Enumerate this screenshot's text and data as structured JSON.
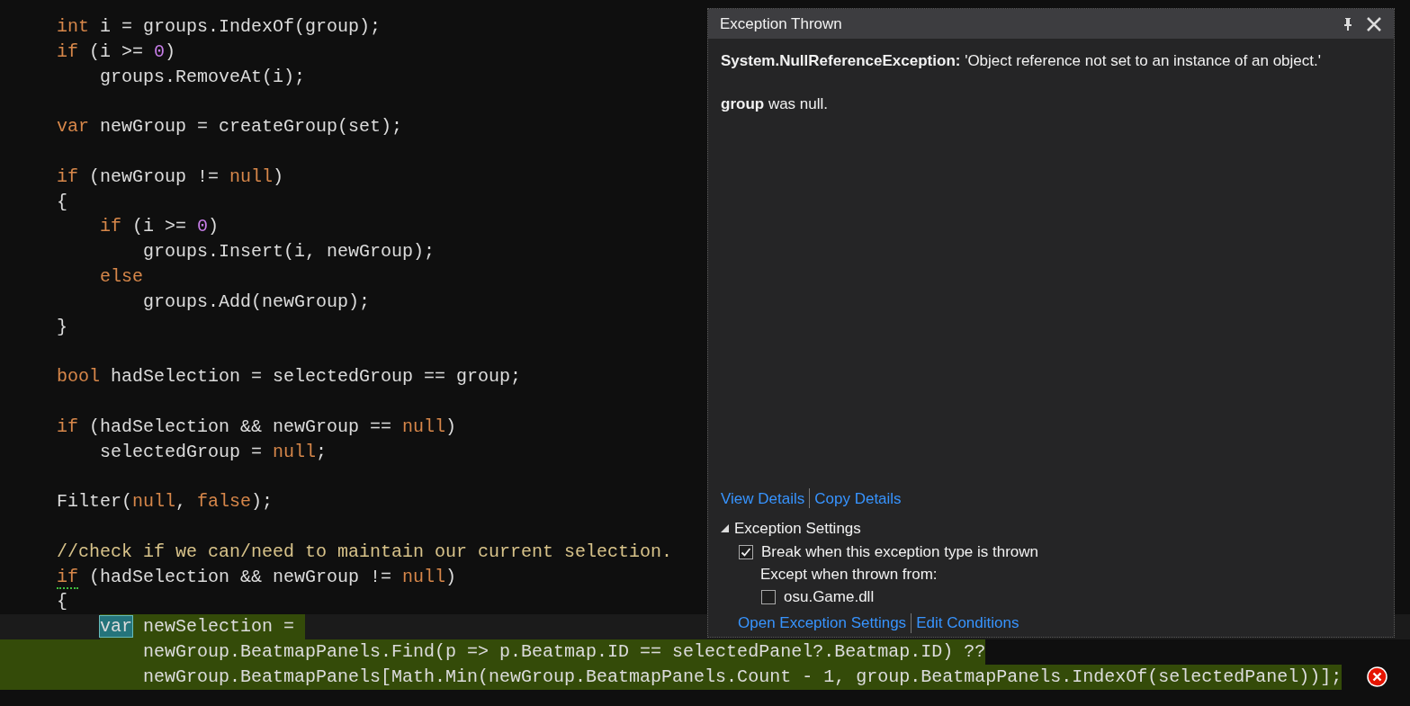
{
  "code": {
    "lines": [
      {
        "kind": "code",
        "tokens": [
          {
            "kind": "keyword",
            "text": "int"
          },
          {
            "kind": "plain",
            "text": " i = groups.IndexOf(group);"
          }
        ]
      },
      {
        "kind": "code",
        "tokens": [
          {
            "kind": "keyword",
            "text": "if"
          },
          {
            "kind": "plain",
            "text": " (i >= "
          },
          {
            "kind": "number",
            "text": "0"
          },
          {
            "kind": "plain",
            "text": ")"
          }
        ]
      },
      {
        "kind": "code",
        "tokens": [
          {
            "kind": "plain",
            "text": "    groups.RemoveAt(i);"
          }
        ]
      },
      {
        "kind": "blank"
      },
      {
        "kind": "code",
        "tokens": [
          {
            "kind": "keyword",
            "text": "var"
          },
          {
            "kind": "plain",
            "text": " newGroup = createGroup(set);"
          }
        ]
      },
      {
        "kind": "blank"
      },
      {
        "kind": "code",
        "tokens": [
          {
            "kind": "keyword",
            "text": "if"
          },
          {
            "kind": "plain",
            "text": " (newGroup != "
          },
          {
            "kind": "keyword",
            "text": "null"
          },
          {
            "kind": "plain",
            "text": ")"
          }
        ]
      },
      {
        "kind": "code",
        "tokens": [
          {
            "kind": "plain",
            "text": "{"
          }
        ]
      },
      {
        "kind": "code",
        "tokens": [
          {
            "kind": "keyword",
            "text": "    if"
          },
          {
            "kind": "plain",
            "text": " (i >= "
          },
          {
            "kind": "number",
            "text": "0"
          },
          {
            "kind": "plain",
            "text": ")"
          }
        ]
      },
      {
        "kind": "code",
        "tokens": [
          {
            "kind": "plain",
            "text": "        groups.Insert(i, newGroup);"
          }
        ]
      },
      {
        "kind": "code",
        "tokens": [
          {
            "kind": "keyword",
            "text": "    else"
          }
        ]
      },
      {
        "kind": "code",
        "tokens": [
          {
            "kind": "plain",
            "text": "        groups.Add(newGroup);"
          }
        ]
      },
      {
        "kind": "code",
        "tokens": [
          {
            "kind": "plain",
            "text": "}"
          }
        ]
      },
      {
        "kind": "blank"
      },
      {
        "kind": "code",
        "tokens": [
          {
            "kind": "keyword",
            "text": "bool"
          },
          {
            "kind": "plain",
            "text": " hadSelection = selectedGroup == group;"
          }
        ]
      },
      {
        "kind": "blank"
      },
      {
        "kind": "code",
        "tokens": [
          {
            "kind": "keyword",
            "text": "if"
          },
          {
            "kind": "plain",
            "text": " (hadSelection && newGroup == "
          },
          {
            "kind": "keyword",
            "text": "null"
          },
          {
            "kind": "plain",
            "text": ")"
          }
        ]
      },
      {
        "kind": "code",
        "tokens": [
          {
            "kind": "plain",
            "text": "    selectedGroup = "
          },
          {
            "kind": "keyword",
            "text": "null"
          },
          {
            "kind": "plain",
            "text": ";"
          }
        ]
      },
      {
        "kind": "blank"
      },
      {
        "kind": "code",
        "tokens": [
          {
            "kind": "plain",
            "text": "Filter("
          },
          {
            "kind": "keyword",
            "text": "null"
          },
          {
            "kind": "plain",
            "text": ", "
          },
          {
            "kind": "keyword",
            "text": "false"
          },
          {
            "kind": "plain",
            "text": ");"
          }
        ]
      },
      {
        "kind": "blank"
      },
      {
        "kind": "code",
        "tokens": [
          {
            "kind": "comment",
            "text": "//check if we can/need to maintain our current selection."
          }
        ]
      },
      {
        "kind": "code",
        "tokens": [
          {
            "kind": "keyword_squiggle",
            "text": "if"
          },
          {
            "kind": "plain",
            "text": " (hadSelection && newGroup != "
          },
          {
            "kind": "keyword",
            "text": "null"
          },
          {
            "kind": "plain",
            "text": ")"
          }
        ]
      },
      {
        "kind": "code",
        "tokens": [
          {
            "kind": "plain",
            "text": "{"
          }
        ]
      },
      {
        "kind": "highlighted",
        "tokens": [
          {
            "kind": "keyword_marked",
            "text": "    var"
          },
          {
            "kind": "plain",
            "text": " newSelection = "
          }
        ]
      },
      {
        "kind": "highlighted_full",
        "tokens": [
          {
            "kind": "plain",
            "text": "        newGroup.BeatmapPanels.Find(p => p.Beatmap.ID == selectedPanel?.Beatmap.ID) ??"
          }
        ]
      },
      {
        "kind": "highlighted_full",
        "tokens": [
          {
            "kind": "plain",
            "text": "        newGroup.BeatmapPanels[Math.Min(newGroup.BeatmapPanels.Count - 1, group.BeatmapPanels.IndexOf(selectedPanel))];"
          }
        ]
      }
    ]
  },
  "popup": {
    "title": "Exception Thrown",
    "message": "**System.NullReferenceException:** 'Object reference not set to an instance of an object.'",
    "detail": "**group** was null.",
    "links": [
      "View Details",
      "Copy Details"
    ],
    "settings": {
      "label": "Exception Settings",
      "expanded": true,
      "break_option": {
        "label": "Break when this exception type is thrown",
        "checked": true
      },
      "except_label": "Except when thrown from:",
      "modules": [
        {
          "label": "osu.Game.dll",
          "checked": false
        }
      ]
    },
    "bottom_links": [
      "Open Exception Settings",
      "Edit Conditions"
    ]
  }
}
